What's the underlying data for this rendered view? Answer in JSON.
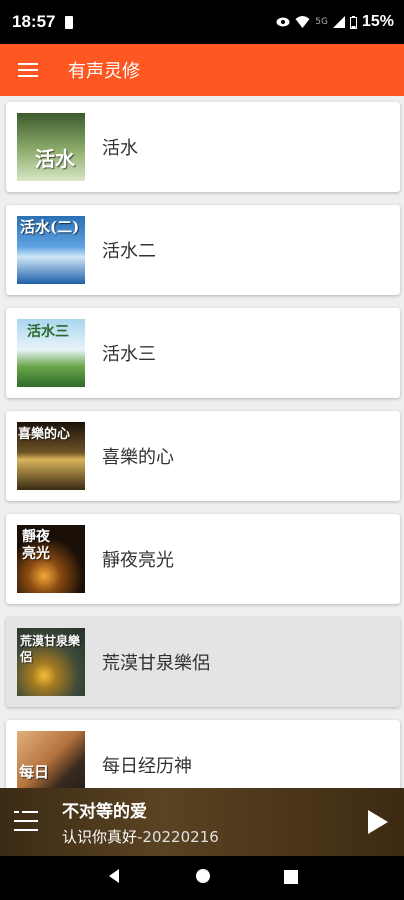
{
  "status_bar": {
    "time": "18:57",
    "network": "5G",
    "battery": "15%"
  },
  "app_bar": {
    "title": "有声灵修"
  },
  "list": {
    "items": [
      {
        "title": "活水",
        "thumb_text": "活水",
        "thumb_colors": [
          "#4e6b3a",
          "#97b37a"
        ]
      },
      {
        "title": "活水二",
        "thumb_text": "活水(二)",
        "thumb_colors": [
          "#1e5fa8",
          "#7fb8e8"
        ]
      },
      {
        "title": "活水三",
        "thumb_text": "活水三",
        "thumb_colors": [
          "#8ec7e8",
          "#3f8a3a"
        ]
      },
      {
        "title": "喜樂的心",
        "thumb_text": "喜樂的心",
        "thumb_colors": [
          "#2a1c0c",
          "#c9a046"
        ]
      },
      {
        "title": "靜夜亮光",
        "thumb_text": "靜夜亮光",
        "thumb_colors": [
          "#120c06",
          "#d7861f"
        ]
      },
      {
        "title": "荒漠甘泉樂侶",
        "thumb_text": "荒漠甘泉樂侶",
        "thumb_colors": [
          "#3e4a3a",
          "#e5a928"
        ],
        "selected": true
      },
      {
        "title": "每日经历神",
        "thumb_text": "每日",
        "thumb_colors": [
          "#c88a56",
          "#2b2b2b"
        ]
      }
    ]
  },
  "player": {
    "title": "不对等的爱",
    "subtitle": "认识你真好",
    "date": "-20220216"
  },
  "colors": {
    "accent": "#ff5722",
    "card_bg": "#ffffff",
    "selected_bg": "#e4e4e4",
    "page_bg": "#efefef"
  }
}
